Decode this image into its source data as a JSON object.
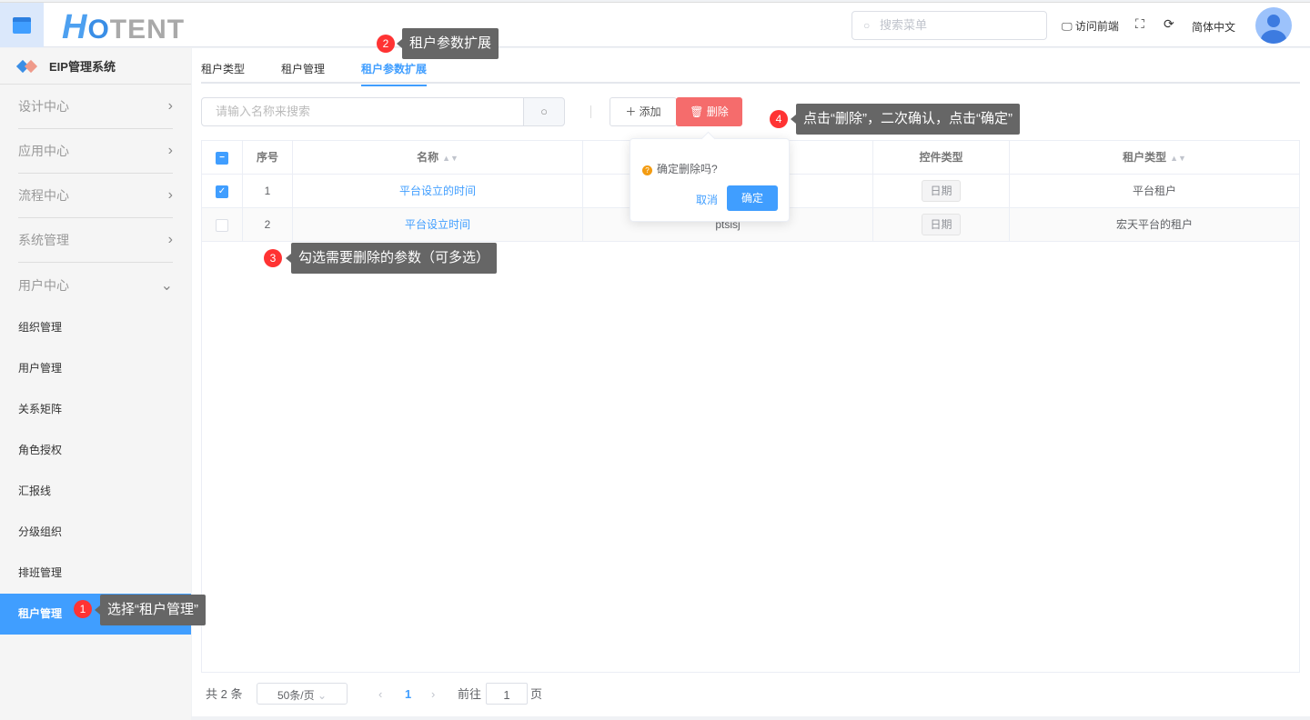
{
  "header": {
    "logo": {
      "h": "H",
      "o": "O",
      "rest": "TENT"
    },
    "search_placeholder": "搜索菜单",
    "visit_frontend": "访问前端",
    "language": "简体中文"
  },
  "sidebar": {
    "system_title": "EIP管理系统",
    "groups": [
      "设计中心",
      "应用中心",
      "流程中心",
      "系统管理",
      "用户中心"
    ],
    "items": [
      "组织管理",
      "用户管理",
      "关系矩阵",
      "角色授权",
      "汇报线",
      "分级组织",
      "排班管理",
      "租户管理"
    ]
  },
  "tabs": [
    "租户类型",
    "租户管理",
    "租户参数扩展"
  ],
  "toolbar": {
    "search_placeholder": "请输入名称来搜索",
    "add": "添加",
    "delete": "删除"
  },
  "table": {
    "headers": {
      "index": "序号",
      "name": "名称",
      "hidden": "",
      "control_type": "控件类型",
      "tenant_type": "租户类型"
    },
    "rows": [
      {
        "index": "1",
        "name": "平台设立的时间",
        "code": "",
        "control": "日期",
        "tenant": "平台租户",
        "checked": true
      },
      {
        "index": "2",
        "name": "平台设立时间",
        "code": "ptsisj",
        "control": "日期",
        "tenant": "宏天平台的租户",
        "checked": false
      }
    ]
  },
  "popconfirm": {
    "message": "确定删除吗?",
    "cancel": "取消",
    "confirm": "确定"
  },
  "pagination": {
    "total": "共 2 条",
    "page_size": "50条/页",
    "current": "1",
    "goto": "前往",
    "goto_value": "1",
    "page_unit": "页"
  },
  "annotations": [
    {
      "n": "1",
      "text": "选择“租户管理”"
    },
    {
      "n": "2",
      "text": "租户参数扩展"
    },
    {
      "n": "3",
      "text": "勾选需要删除的参数（可多选）"
    },
    {
      "n": "4",
      "text": "点击“删除”，二次确认，点击“确定”"
    }
  ]
}
